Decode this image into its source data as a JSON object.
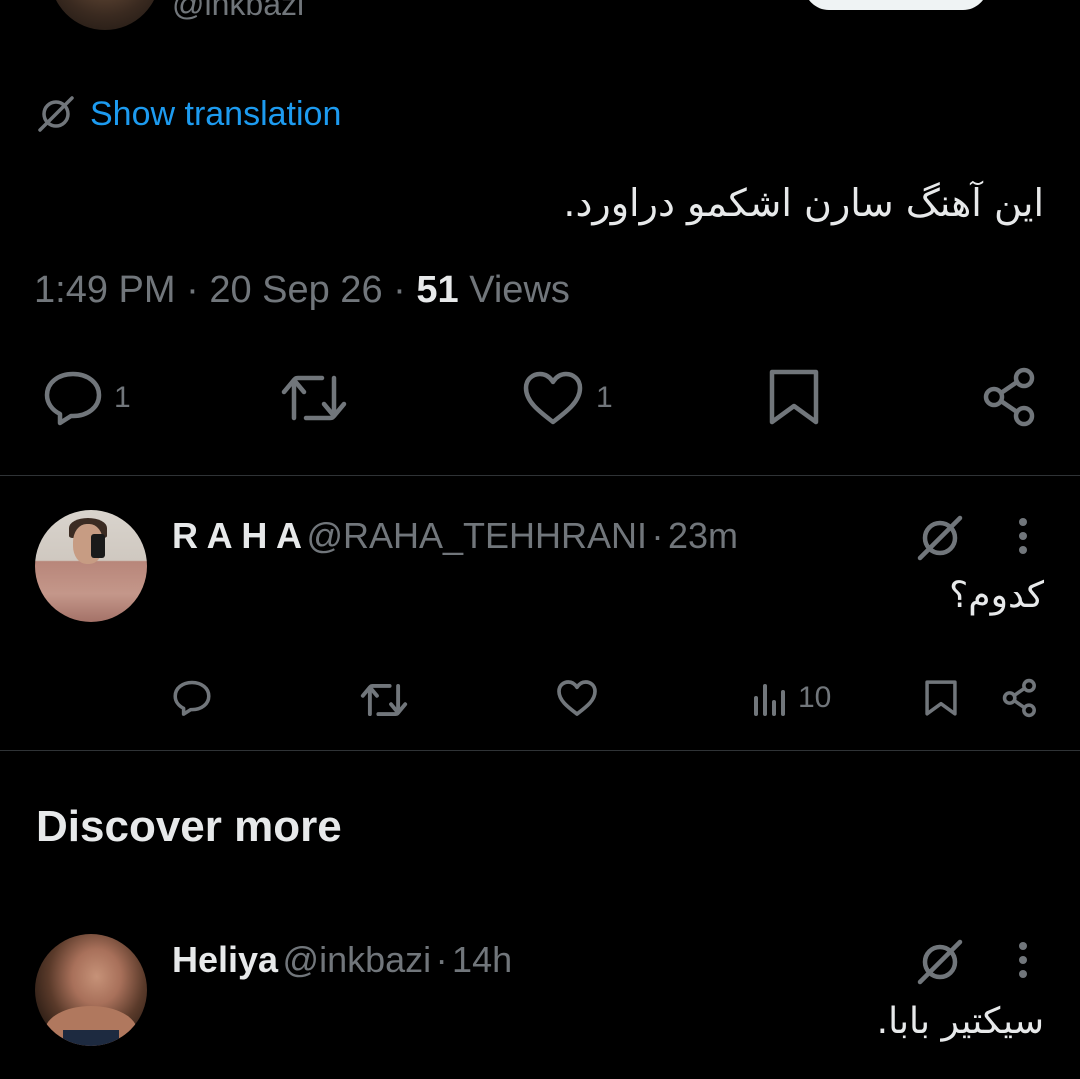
{
  "top": {
    "handle": "@inkbazi"
  },
  "translation": {
    "label": "Show translation"
  },
  "tweet": {
    "text": "این آهنگ سارن اشکمو دراورد.",
    "time": "1:49 PM",
    "date": "20 Sep 26",
    "views_count": "51",
    "views_label": "Views",
    "separator": "·",
    "reply_count": "1",
    "like_count": "1"
  },
  "reply": {
    "name": "R A H A",
    "handle": "@RAHA_TEHHRANI",
    "separator": "·",
    "time": "23m",
    "text": "کدوم؟",
    "views_count": "10"
  },
  "discover": {
    "title": "Discover more"
  },
  "post2": {
    "name": "Heliya",
    "handle": "@inkbazi",
    "separator": "·",
    "time": "14h",
    "text": "سیکتیر بابا."
  },
  "colors": {
    "background": "#000000",
    "text": "#e7e9ea",
    "muted": "#71767b",
    "link": "#1d9bf0",
    "divider": "#2f3336"
  }
}
